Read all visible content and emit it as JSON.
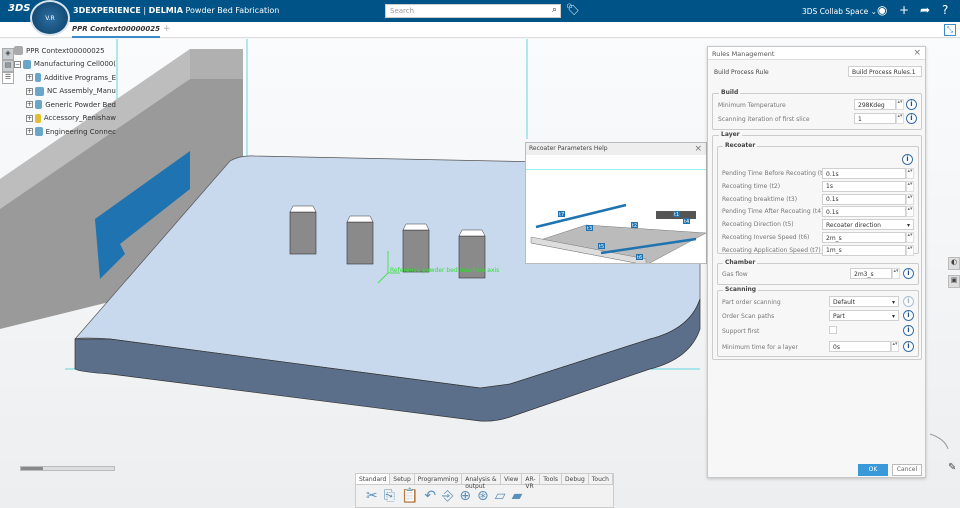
{
  "topbar": {
    "logo": "3DS",
    "compass": "V.R",
    "brand": "3DEXPERIENCE",
    "separator": " | ",
    "app_brand": "DELMIA",
    "app_name": " Powder Bed Fabrication",
    "search_placeholder": "Search",
    "collab_space": "3DS Collab Space ⌄"
  },
  "tabs": [
    {
      "label": "PPR Context00000025"
    }
  ],
  "tree": {
    "root": "PPR Context00000025",
    "cell": "Manufacturing Cell000(",
    "children": [
      "Additive Programs_E",
      "NC Assembly_Manu",
      "Generic Powder Bed",
      "Accessory_Renishaw",
      "Engineering Connec"
    ]
  },
  "viewport": {
    "axis_label": "Reference powder bed machine axis"
  },
  "help_panel": {
    "title": "Recoater Parameters Help",
    "labels": [
      "t7",
      "t3",
      "t2",
      "t5",
      "t1",
      "t4",
      "t6"
    ]
  },
  "dialog": {
    "title": "Rules Management",
    "rule_label": "Build Process Rule",
    "rule_value": "Build Process Rules.1",
    "build": {
      "title": "Build",
      "fields": [
        {
          "label": "Minimum Temperature",
          "value": "298Kdeg"
        },
        {
          "label": "Scanning iteration of first slice",
          "value": "1"
        }
      ]
    },
    "layer_title": "Layer",
    "recoater": {
      "title": "Recoater",
      "fields": [
        {
          "label": "Pending Time Before Recoating (t1)",
          "value": "0.1s"
        },
        {
          "label": "Recoating time (t2)",
          "value": "1s"
        },
        {
          "label": "Recoating breaktime (t3)",
          "value": "0.1s"
        },
        {
          "label": "Pending Time After Recoating (t4)",
          "value": "0.1s"
        },
        {
          "label": "Recoating Direction (t5)",
          "value": "Recoater direction"
        },
        {
          "label": "Recoating Inverse Speed (t6)",
          "value": "2m_s"
        },
        {
          "label": "Recoating Application Speed (t7)",
          "value": "1m_s"
        }
      ]
    },
    "chamber": {
      "title": "Chamber",
      "label": "Gas flow",
      "value": "2m3_s"
    },
    "scanning": {
      "title": "Scanning",
      "fields": [
        {
          "label": "Part order scanning",
          "value": "Default"
        },
        {
          "label": "Order Scan paths",
          "value": "Part"
        },
        {
          "label": "Support first",
          "value": ""
        },
        {
          "label": "Minimum time for a layer",
          "value": "0s"
        }
      ]
    },
    "ok": "OK",
    "cancel": "Cancel"
  },
  "toolbar": {
    "tabs": [
      "Standard",
      "Setup",
      "Programming",
      "Analysis & output",
      "View",
      "AR-VR",
      "Tools",
      "Debug",
      "Touch"
    ],
    "active": "Standard"
  },
  "colors": {
    "topbar": "#005386",
    "accent": "#3a9ad9",
    "bed": "#c8d9ee",
    "arrow": "#1e73b0"
  }
}
